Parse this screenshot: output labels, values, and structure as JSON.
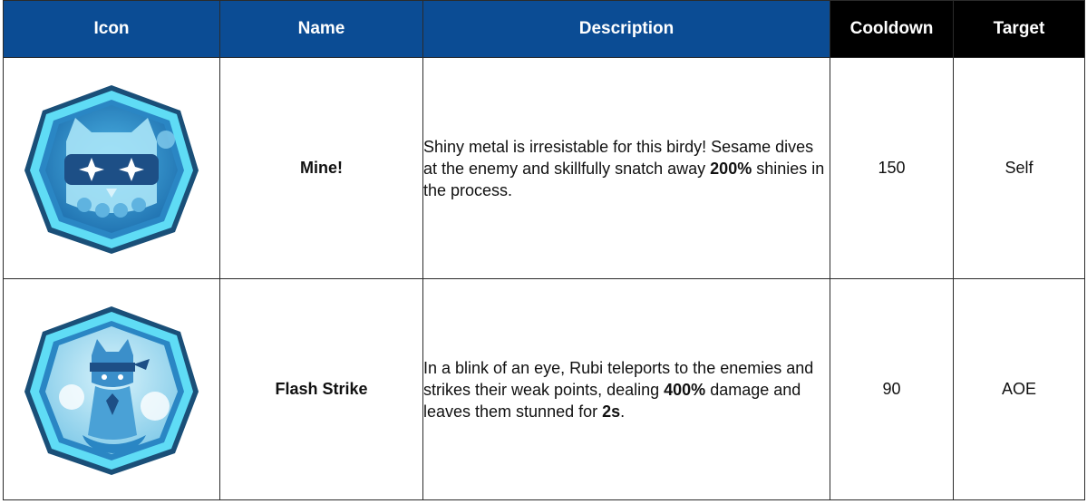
{
  "table": {
    "headers": {
      "icon": "Icon",
      "name": "Name",
      "description": "Description",
      "cooldown": "Cooldown",
      "target": "Target"
    },
    "header_colors": {
      "blue": "#0b4c94",
      "black": "#000000"
    },
    "rows": [
      {
        "icon": "sesame-bird-skill-badge-icon",
        "name": "Mine!",
        "description": {
          "pre": "Shiny metal is irresistable for this birdy! Sesame dives at the enemy and skillfully snatch away ",
          "bold1": "200%",
          "post": " shinies in the process."
        },
        "cooldown": "150",
        "target": "Self"
      },
      {
        "icon": "rubi-cat-skill-badge-icon",
        "name": "Flash Strike",
        "description": {
          "pre": "In a blink of an eye, Rubi teleports to the enemies and strikes their weak points, dealing ",
          "bold1": "400%",
          "mid": " damage and leaves them stunned for ",
          "bold2": "2s",
          "post": "."
        },
        "cooldown": "90",
        "target": "AOE"
      }
    ]
  }
}
